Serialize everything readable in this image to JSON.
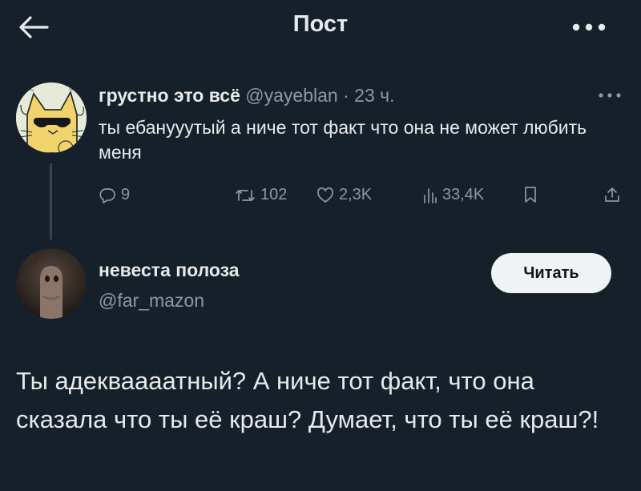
{
  "header": {
    "title": "Пост",
    "back_icon": "arrow-left-icon",
    "more_icon": "more-horizontal-icon"
  },
  "parent_tweet": {
    "author_name": "грустно это всё",
    "handle": "@yayeblan",
    "separator": "·",
    "time": "23 ч.",
    "text": "ты ебанууутый а ниче тот факт что она не может любить меня",
    "stats": {
      "replies": "9",
      "retweets": "102",
      "likes": "2,3K",
      "views": "33,4K"
    }
  },
  "quoted_profile": {
    "name": "невеста полоза",
    "handle": "@far_mazon",
    "follow_label": "Читать"
  },
  "reply": {
    "text": "Ты адекваааатный? А ниче тот факт, что она сказала что ты её краш? Думает, что ты её краш?!"
  },
  "colors": {
    "background": "#15202b",
    "text": "#e7e9ea",
    "muted": "#8b98a5",
    "button_bg": "#eff3f4"
  }
}
